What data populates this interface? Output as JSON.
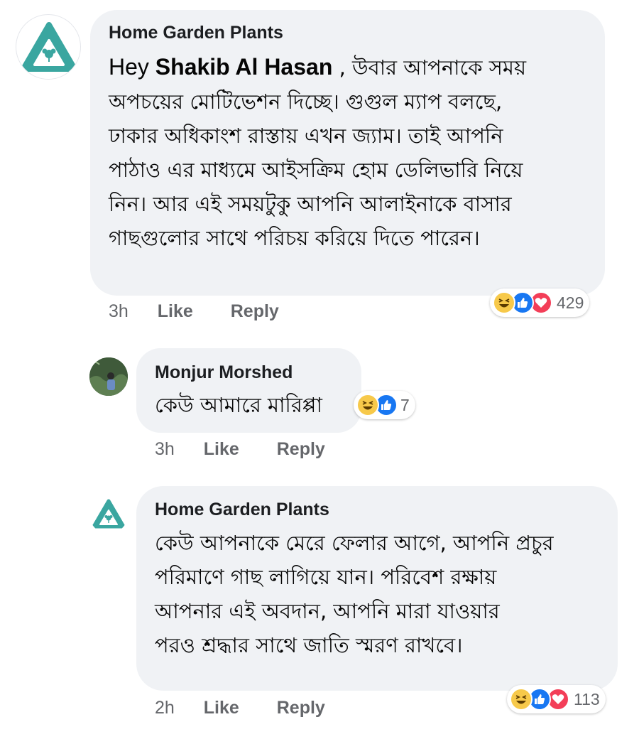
{
  "comments": [
    {
      "author": "Home Garden Plants",
      "greeting": "Hey ",
      "mention": "Shakib Al Hasan",
      "lines": [
        " , উবার আপনাকে সময়",
        "অপচয়ের মোটিভেশন দিচ্ছে। গুগুল ম্যাপ বলছে,",
        "ঢাকার অধিকাংশ রাস্তায় এখন জ্যাম। তাই আপনি",
        "পাঠাও এর মাধ্যমে আইসক্রিম হোম ডেলিভারি নিয়ে",
        "নিন। আর এই সময়টুকু আপনি আলাইনাকে  বাসার",
        "গাছগুলোর সাথে পরিচয় করিয়ে দিতে  পারেন।"
      ],
      "time": "3h",
      "like_label": "Like",
      "reply_label": "Reply",
      "reaction_count": "429",
      "reaction_icons": [
        "haha-icon",
        "like-icon",
        "love-icon"
      ]
    },
    {
      "author": "Monjur Morshed",
      "lines": [
        "কেউ আমারে মারিপ্পা"
      ],
      "time": "3h",
      "like_label": "Like",
      "reply_label": "Reply",
      "reaction_count": "7",
      "reaction_icons": [
        "haha-icon",
        "like-icon"
      ]
    },
    {
      "author": "Home Garden Plants",
      "lines": [
        "কেউ আপনাকে মেরে ফেলার আগে, আপনি প্রচুর",
        "পরিমাণে গাছ লাগিয়ে যান। পরিবেশ রক্ষায়",
        "আপনার এই অবদান, আপনি মারা যাওয়ার",
        "পরও শ্রদ্ধার সাথে জাতি স্মরণ রাখবে।"
      ],
      "time": "2h",
      "like_label": "Like",
      "reply_label": "Reply",
      "reaction_count": "113",
      "reaction_icons": [
        "haha-icon",
        "like-icon",
        "love-icon"
      ]
    }
  ],
  "colors": {
    "bubble": "#f0f2f5",
    "meta_text": "#65676b",
    "brand_teal": "#3aa6a0",
    "like_blue": "#1877f2",
    "love_red": "#f33e58",
    "haha_yellow": "#f7c94a"
  }
}
